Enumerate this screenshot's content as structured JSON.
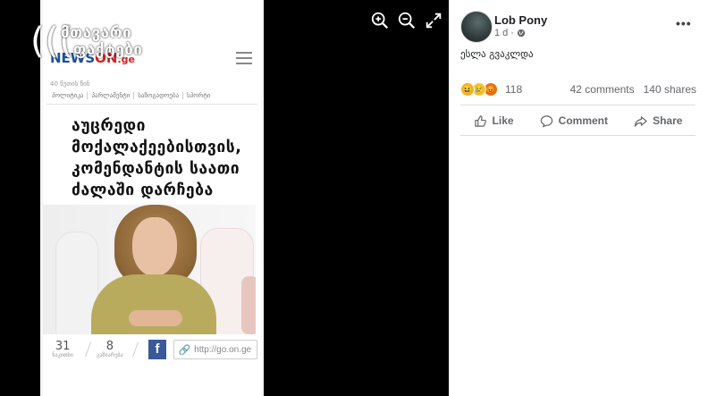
{
  "viewer": {
    "watermark_line1": "მთავარი",
    "watermark_line2": "ფაქტები",
    "tools": {
      "zoom_in": "zoom-in-icon",
      "zoom_out": "zoom-out-icon",
      "fullscreen": "fullscreen-icon"
    }
  },
  "article": {
    "brand_news": "NEWS",
    "brand_on": "ON",
    "brand_ge": ".ge",
    "time_ago": "40 წუთის წინ",
    "categories": [
      "პოლიტიკა",
      "პარლამენტი",
      "საზოგადოება",
      "სპორტი"
    ],
    "headline": "აუცრედი მოქალაქეებისთვის, კომენდანტის საათი ძალაში დარჩება",
    "share_count": "31",
    "share_label": "ნაკითხი",
    "comment_count": "8",
    "comment_label": "გაზიარება",
    "fb_letter": "f",
    "url": "http://go.on.ge"
  },
  "post": {
    "author": "Lob Pony",
    "time": "1 d",
    "privacy_icon": "globe-icon",
    "text": "ესლა გვაკლდა",
    "reaction_count": "118",
    "comments": "42 comments",
    "shares": "140 shares",
    "actions": {
      "like": "Like",
      "comment": "Comment",
      "share": "Share"
    },
    "more_label": "•••"
  }
}
